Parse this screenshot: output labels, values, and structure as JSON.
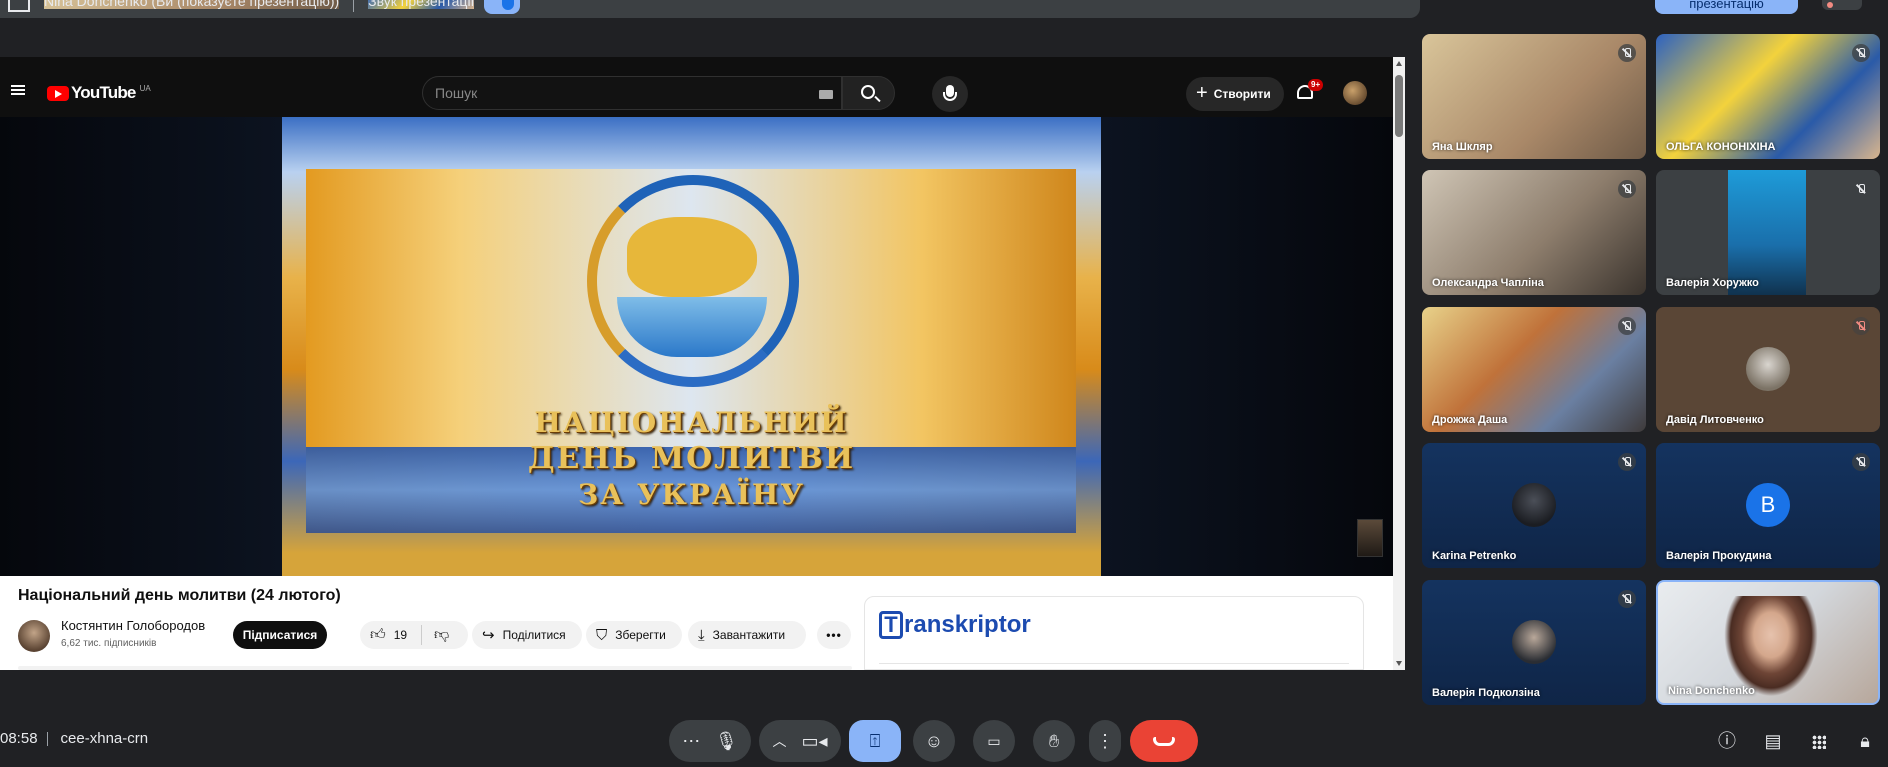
{
  "topbar": {
    "presenter_text": "Nina Donchenko (Ви (показуєте презентацію))",
    "audio_text": "Звук презентації",
    "stop_present_text": "презентацію"
  },
  "youtube": {
    "logo_text": "YouTube",
    "region": "UA",
    "search_placeholder": "Пошук",
    "create_label": "Створити",
    "notification_badge": "9+",
    "video": {
      "title_lines": [
        "НАЦІОНАЛЬНИЙ",
        "ДЕНЬ МОЛИТВИ",
        "ЗА УКРАЇНУ"
      ]
    },
    "video_title": "Національний день молитви (24 лютого)",
    "channel_name": "Костянтин Голобородов",
    "subscribers": "6,62 тис. підписників",
    "subscribe_label": "Підписатися",
    "like_count": "19",
    "share_label": "Поділитися",
    "save_label": "Зберегти",
    "download_label": "Завантажити",
    "more_label": "•••",
    "transkriptor_name": "ranskriptor",
    "transkriptor_letter": "T"
  },
  "participants": [
    {
      "name": "Яна Шкляр",
      "muted": true
    },
    {
      "name": "ОЛЬГА КОНОНІХІНА",
      "muted": true
    },
    {
      "name": "Олександра Чапліна",
      "muted": true
    },
    {
      "name": "Валерія Хоружко",
      "muted": true
    },
    {
      "name": "Дрожжа Даша",
      "muted": true
    },
    {
      "name": "Давід Литовченко",
      "muted": true
    },
    {
      "name": "Karina Petrenko",
      "muted": true
    },
    {
      "name": "Валерія Прокудина",
      "muted": true,
      "initial": "В"
    },
    {
      "name": "Валерія Подколзіна",
      "muted": true
    },
    {
      "name": "Nina Donchenko",
      "muted": false
    }
  ],
  "meeting": {
    "time": "08:58",
    "code": "cee-xhna-crn"
  },
  "colors": {
    "accent": "#8ab4f8",
    "leave_red": "#ea4335",
    "surface": "#3c4043",
    "background": "#202124"
  }
}
